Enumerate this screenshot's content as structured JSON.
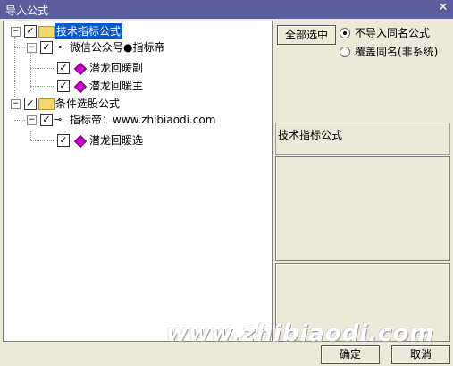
{
  "window": {
    "title": "导入公式",
    "close_glyph": "✕"
  },
  "tree": {
    "nodes": [
      {
        "label": "技术指标公式",
        "checked": "✓",
        "expander": "−"
      },
      {
        "label": "微信公众号●指标帝",
        "checked": "✓",
        "expander": "−"
      },
      {
        "label": "潜龙回暖副",
        "checked": "✓"
      },
      {
        "label": "潜龙回暖主",
        "checked": "✓"
      },
      {
        "label": "条件选股公式",
        "checked": "✓",
        "expander": "−"
      },
      {
        "label": "指标帝：www.zhibiaodi.com",
        "checked": "✓",
        "expander": "−"
      },
      {
        "label": "潜龙回暖选",
        "checked": "✓"
      }
    ]
  },
  "right": {
    "select_all_label": "全部选中",
    "radio_no_import": "不导入同名公式",
    "radio_overwrite": "覆盖同名(非系统)",
    "info_text": "技术指标公式"
  },
  "footer": {
    "ok_label": "确定",
    "cancel_label": "取消"
  },
  "watermark": "www.zhibiaodi.com"
}
